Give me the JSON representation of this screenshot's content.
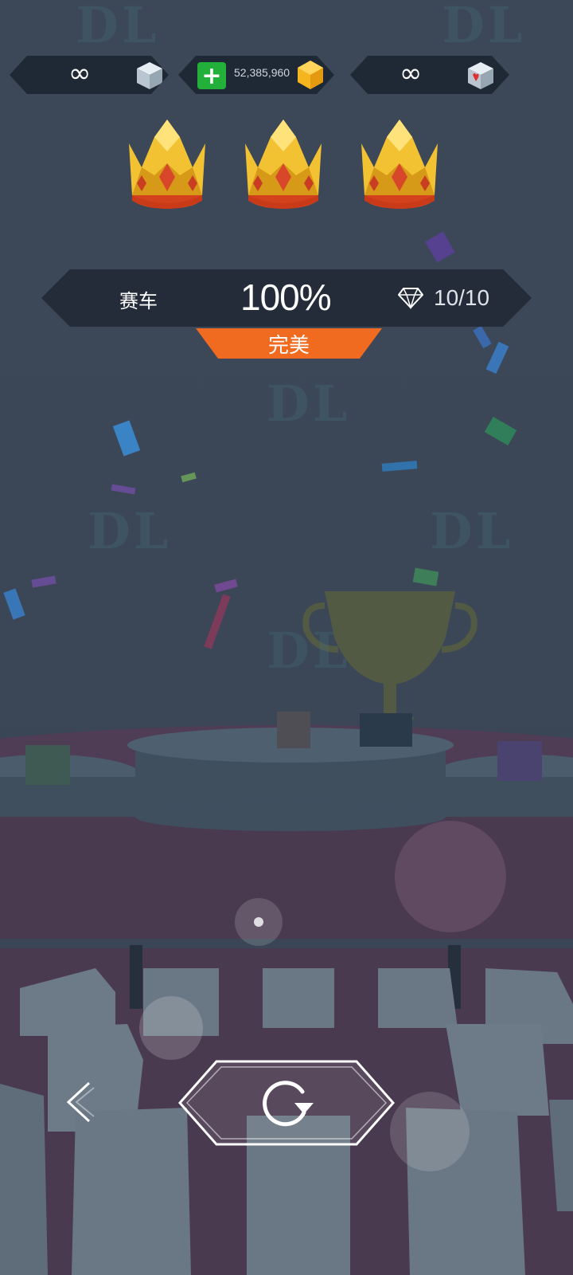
{
  "top_bar": {
    "left_counter": {
      "value": "∞",
      "icon": "gray-cube-icon"
    },
    "coins": {
      "value": "52,385,960",
      "add_icon": "plus-icon",
      "icon": "gold-coin-icon"
    },
    "right_counter": {
      "value": "∞",
      "icon": "heart-cube-icon"
    }
  },
  "rating": {
    "crowns": 3,
    "max_crowns": 3
  },
  "result": {
    "mode": "赛车",
    "percent": "100%",
    "gem_icon": "diamond-icon",
    "gems": "10/10",
    "grade": "完美"
  },
  "watermark": "DL",
  "nav": {
    "back_icon": "chevron-left-icon",
    "replay_icon": "replay-icon"
  },
  "colors": {
    "grade_banner": "#f06a1f",
    "plus_button": "#22b03a",
    "panel": "#232c38"
  }
}
